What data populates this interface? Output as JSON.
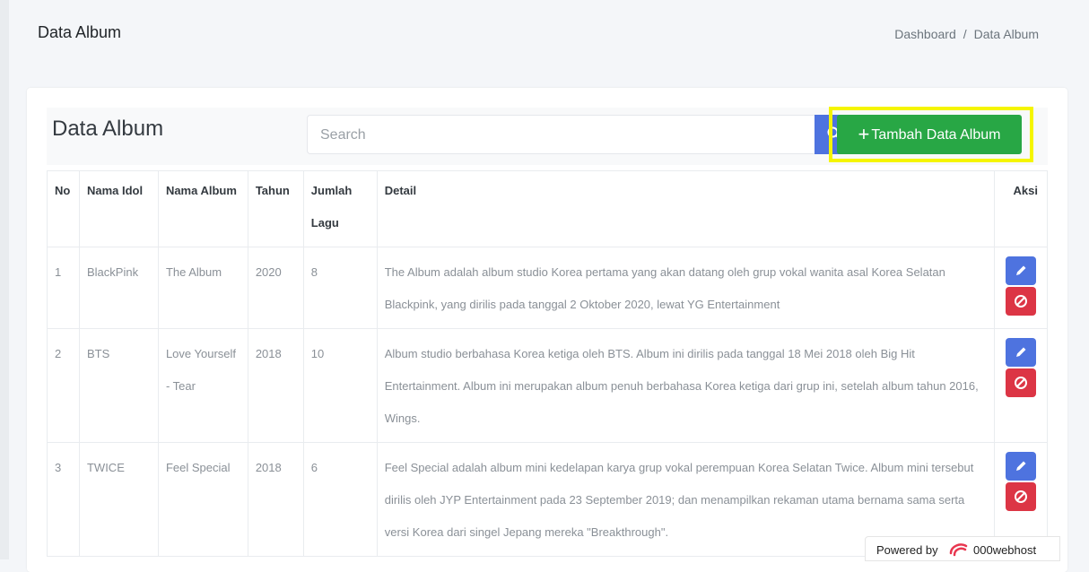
{
  "page": {
    "title": "Data Album",
    "breadcrumb": [
      "Dashboard",
      "/",
      "Data Album"
    ]
  },
  "card": {
    "title": "Data Album",
    "search": {
      "placeholder": "Search",
      "value": "",
      "icon": "search-icon"
    },
    "add_button": {
      "icon": "plus",
      "label": "Tambah Data Album"
    }
  },
  "table": {
    "headers": [
      "No",
      "Nama Idol",
      "Nama Album",
      "Tahun",
      "Jumlah Lagu",
      "Detail",
      "Aksi"
    ],
    "rows": [
      {
        "no": "1",
        "idol": "BlackPink",
        "album": "The Album",
        "tahun": "2020",
        "jumlah": "8",
        "detail": "The Album adalah album studio Korea pertama yang akan datang oleh grup vokal wanita asal Korea Selatan Blackpink, yang dirilis pada tanggal 2 Oktober 2020, lewat YG Entertainment"
      },
      {
        "no": "2",
        "idol": "BTS",
        "album": "Love Yourself - Tear",
        "tahun": "2018",
        "jumlah": "10",
        "detail": "Album studio berbahasa Korea ketiga oleh BTS. Album ini dirilis pada tanggal 18 Mei 2018 oleh Big Hit Entertainment. Album ini merupakan album penuh berbahasa Korea ketiga dari grup ini, setelah album tahun 2016, Wings."
      },
      {
        "no": "3",
        "idol": "TWICE",
        "album": "Feel Special",
        "tahun": "2018",
        "jumlah": "6",
        "detail": "Feel Special adalah album mini kedelapan karya grup vokal perempuan Korea Selatan Twice. Album mini tersebut dirilis oleh JYP Entertainment pada 23 September 2019; dan menampilkan rekaman utama bernama sama serta versi Korea dari singel Jepang mereka \"Breakthrough\"."
      }
    ]
  },
  "colors": {
    "primary": "#4e73df",
    "success": "#28a745",
    "danger": "#dc3545",
    "highlight": "#f5f500"
  },
  "footer_badge": {
    "prefix": "Powered by",
    "brand": "000webhost"
  }
}
